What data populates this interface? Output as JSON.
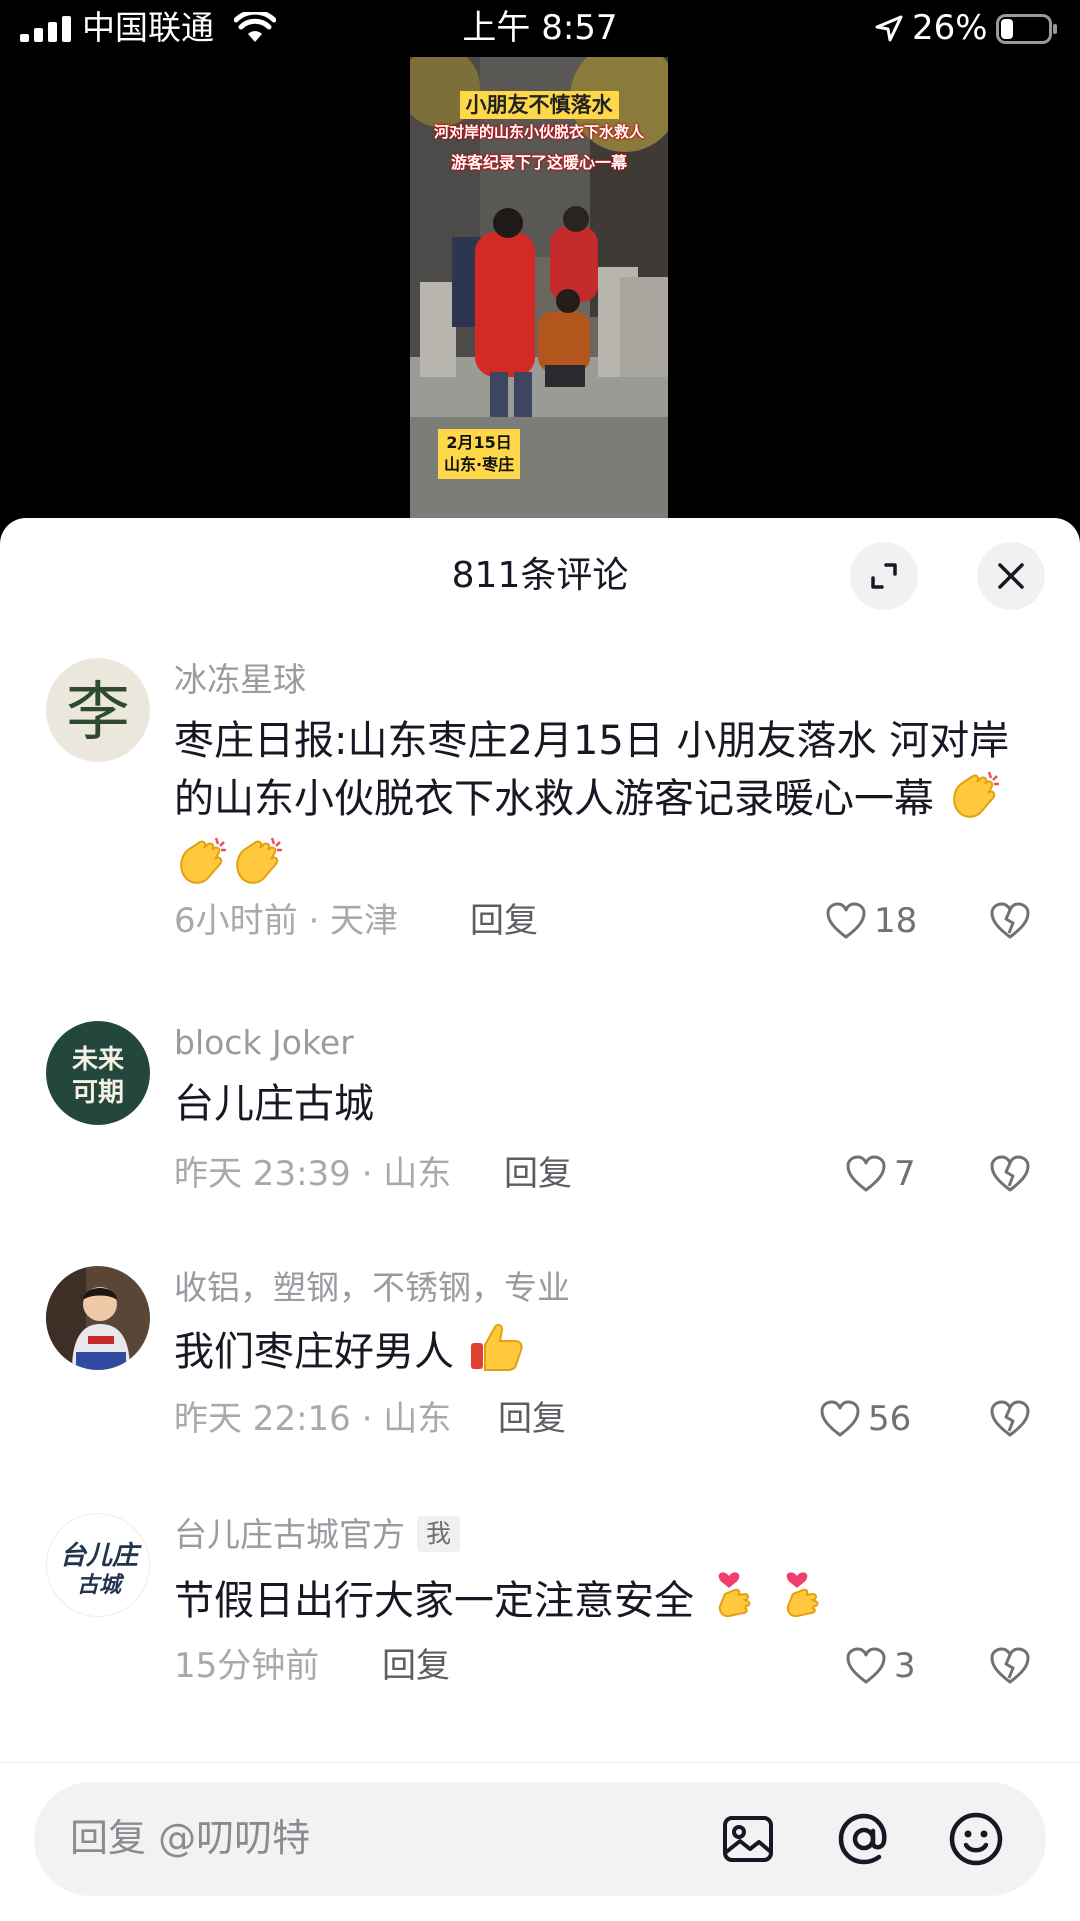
{
  "status_bar": {
    "carrier": "中国联通",
    "time": "上午 8:57",
    "battery_pct": "26%",
    "battery_level": 0.26
  },
  "video": {
    "caption_title": "小朋友不慎落水",
    "caption_line1": "河对岸的山东小伙脱衣下水救人",
    "caption_line2": "游客纪录下了这暖心一幕",
    "date_line1": "2月15日",
    "date_line2": "山东·枣庄"
  },
  "sheet": {
    "title": "811条评论"
  },
  "comments": [
    {
      "username": "冰冻星球",
      "text": "枣庄日报:山东枣庄2月15日 小朋友落水 河对岸的山东小伙脱衣下水救人游客记录暖心一幕",
      "emojis": [
        "clapping-hands",
        "clapping-hands",
        "clapping-hands"
      ],
      "meta": "6小时前 · 天津",
      "reply_label": "回复",
      "likes": "18",
      "avatar_glyph": "李"
    },
    {
      "username": "block Joker",
      "text": "台儿庄古城",
      "emojis": [],
      "meta": "昨天 23:39 · 山东",
      "reply_label": "回复",
      "likes": "7",
      "avatar_text": "未来可期"
    },
    {
      "username": "收铝，塑钢，不锈钢，专业",
      "text": "我们枣庄好男人",
      "emojis": [
        "thumbs-up"
      ],
      "meta": "昨天 22:16 · 山东",
      "reply_label": "回复",
      "likes": "56"
    },
    {
      "username": "台儿庄古城官方",
      "badge": "我",
      "text": "节假日出行大家一定注意安全",
      "emojis": [
        "finger-heart",
        "finger-heart"
      ],
      "meta": "15分钟前",
      "reply_label": "回复",
      "likes": "3",
      "avatar_text": "台儿庄古城"
    }
  ],
  "input": {
    "placeholder": "回复 @叨叨特"
  },
  "icons": {
    "expand": "expand-icon",
    "close": "close-icon",
    "like": "heart-outline-icon",
    "dislike": "broken-heart-icon",
    "image": "image-icon",
    "mention": "at-icon",
    "emoji": "smiley-icon"
  },
  "colors": {
    "text_primary": "#161823",
    "text_secondary": "#9a9ba0",
    "sheet_bg": "#ffffff",
    "input_bg": "#f2f2f3"
  }
}
